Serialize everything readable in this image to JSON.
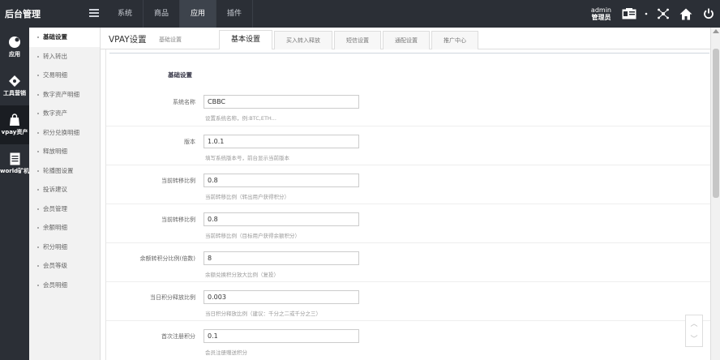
{
  "brand": "后台管理",
  "topnav": [
    "系统",
    "商品",
    "应用",
    "插件"
  ],
  "topnav_active": 2,
  "user": {
    "name": "admin",
    "role": "管理员"
  },
  "iconbar": [
    {
      "label": "应用",
      "icon": "puzzle-icon"
    },
    {
      "label": "工具营销",
      "icon": "tag-icon"
    },
    {
      "label": "vpay资产",
      "icon": "bag-icon"
    },
    {
      "label": "world矿机",
      "icon": "document-icon"
    }
  ],
  "iconbar_active": 2,
  "submenu": [
    "基础设置",
    "转入转出",
    "交易明细",
    "数字资产明细",
    "数字资产",
    "积分兑换明细",
    "释放明细",
    "轮播图设置",
    "投诉建议",
    "会员管理",
    "余额明细",
    "积分明细",
    "会员等级",
    "会员明细"
  ],
  "submenu_active": 0,
  "page": {
    "title": "VPAY设置",
    "subtitle": "基础设置"
  },
  "tabs": [
    "基本设置",
    "买入转入释放",
    "短信设置",
    "通配设置",
    "推广中心"
  ],
  "tabs_active": 0,
  "section_title": "基础设置",
  "fields": [
    {
      "label": "系统名称",
      "value": "CBBC",
      "help": "设置系统名称，例:BTC,ETH..."
    },
    {
      "label": "版本",
      "value": "1.0.1",
      "help": "填写系统版本号，前台显示当前版本"
    },
    {
      "label": "当前转移比例",
      "value": "0.8",
      "help": "当前转移比例（转出用户获得积分）"
    },
    {
      "label": "当前转移比例",
      "value": "0.8",
      "help": "当前转移比例（目标用户获得余额积分）"
    },
    {
      "label": "余额转积分比例(倍数)",
      "value": "8",
      "help": "余额兑换积分放大比例（复投）"
    },
    {
      "label": "当日积分释放比例",
      "value": "0.003",
      "help": "当日积分释放比例（建议：千分之二或千分之三）"
    },
    {
      "label": "首次注册积分",
      "value": "0.1",
      "help": "会员注册赠送积分"
    }
  ]
}
